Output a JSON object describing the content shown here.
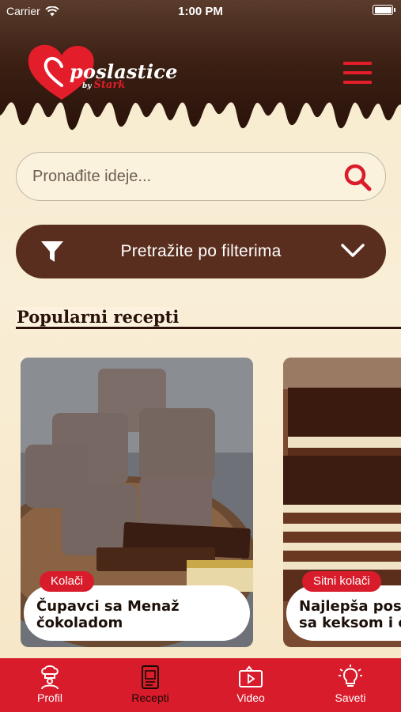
{
  "status_bar": {
    "carrier": "Carrier",
    "time": "1:00 PM"
  },
  "header": {
    "logo_text": "poslastice",
    "logo_by": "by",
    "logo_brand": "Štark"
  },
  "search": {
    "placeholder": "Pronađite ideje..."
  },
  "filter": {
    "label": "Pretražite po filterima"
  },
  "section": {
    "title": "Popularni recepti"
  },
  "cards": [
    {
      "badge": "Kolači",
      "title": "Čupavci sa Menaž\nčokoladom"
    },
    {
      "badge": "Sitni kolači",
      "title": "Najlepša pos\nsa keksom i č"
    }
  ],
  "tabs": [
    {
      "label": "Profil",
      "icon": "chef-icon",
      "active": false
    },
    {
      "label": "Recepti",
      "icon": "recipe-book-icon",
      "active": true
    },
    {
      "label": "Video",
      "icon": "video-icon",
      "active": false
    },
    {
      "label": "Saveti",
      "icon": "lightbulb-icon",
      "active": false
    }
  ],
  "colors": {
    "brand_red": "#d81c2b",
    "chocolate": "#5a2e1e",
    "background": "#f7eacd"
  }
}
